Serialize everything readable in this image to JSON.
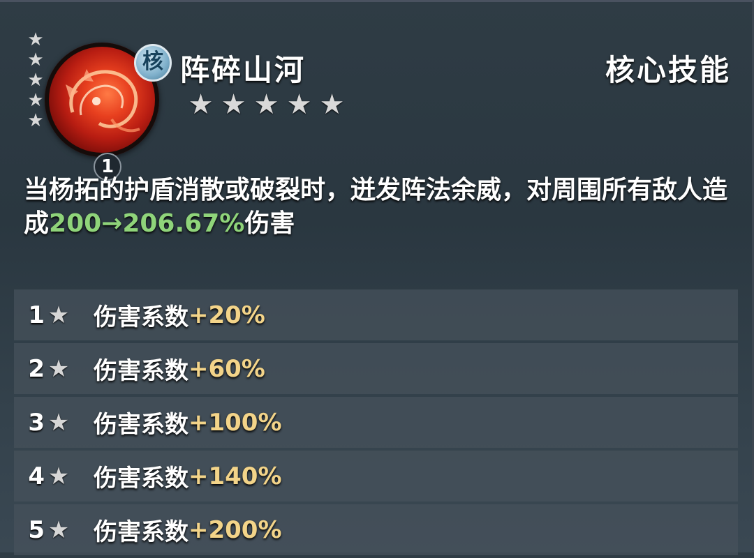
{
  "skill": {
    "name": "阵碎山河",
    "type": "核心技能",
    "core_badge": "核",
    "level": "1",
    "icon": "red-dragon-emblem-icon",
    "side_stars": [
      "★",
      "★",
      "★",
      "★",
      "★"
    ],
    "stars": [
      "★",
      "★",
      "★",
      "★",
      "★"
    ]
  },
  "description": {
    "line_prefix": "当杨拓的护盾消散或破裂时，迸发阵法余威，对周围所有敌人造成",
    "value": "200→206.67%",
    "suffix": "伤害"
  },
  "upgrades": [
    {
      "level": "1",
      "star": "★",
      "label": "伤害系数",
      "value": "+20%"
    },
    {
      "level": "2",
      "star": "★",
      "label": "伤害系数",
      "value": "+60%"
    },
    {
      "level": "3",
      "star": "★",
      "label": "伤害系数",
      "value": "+100%"
    },
    {
      "level": "4",
      "star": "★",
      "label": "伤害系数",
      "value": "+140%"
    },
    {
      "level": "5",
      "star": "★",
      "label": "伤害系数",
      "value": "+200%"
    }
  ],
  "colors": {
    "highlight_green": "#8fd47a",
    "highlight_gold": "#f3d489"
  }
}
